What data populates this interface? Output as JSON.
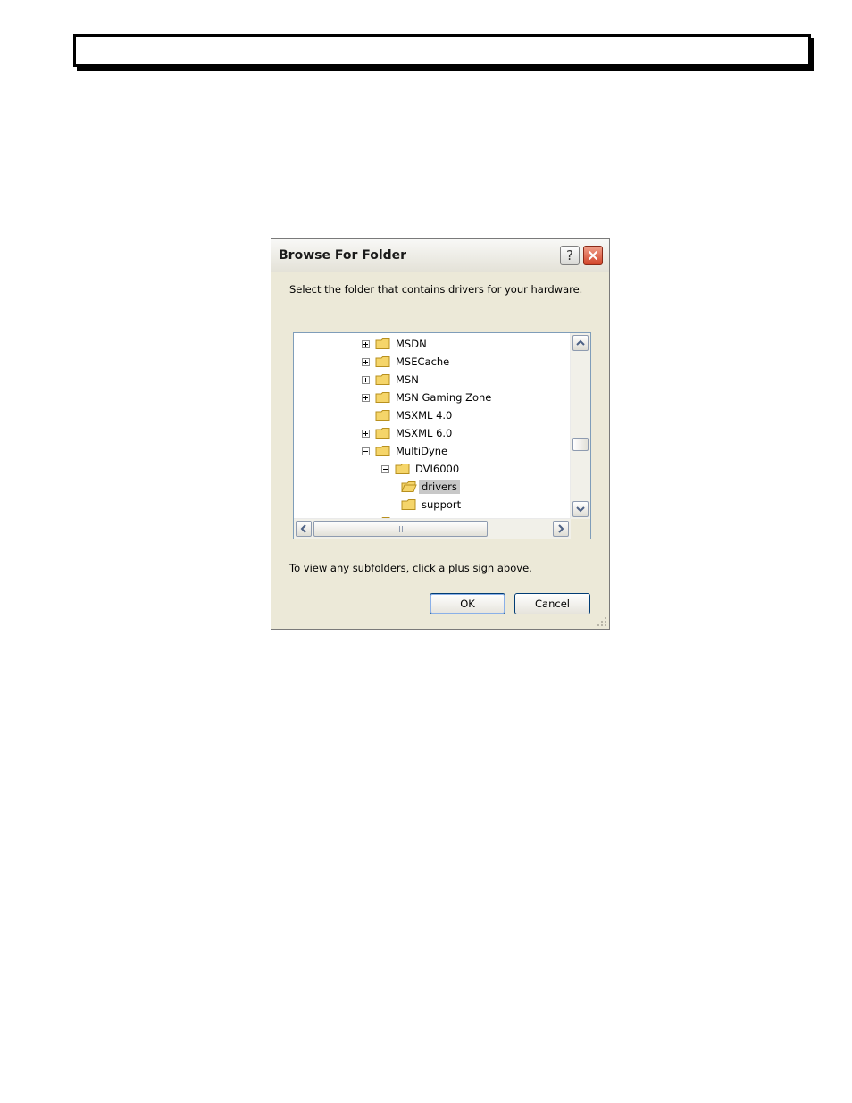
{
  "dialog": {
    "title": "Browse For Folder",
    "help_label": "?",
    "prompt": "Select the folder that contains drivers for your hardware.",
    "hint": "To view any subfolders, click a plus sign above.",
    "ok_label": "OK",
    "cancel_label": "Cancel"
  },
  "tree": {
    "items": [
      {
        "label": "MSDN",
        "expander": "plus",
        "level": 0
      },
      {
        "label": "MSECache",
        "expander": "plus",
        "level": 0
      },
      {
        "label": "MSN",
        "expander": "plus",
        "level": 0
      },
      {
        "label": "MSN Gaming Zone",
        "expander": "plus",
        "level": 0
      },
      {
        "label": "MSXML 4.0",
        "expander": "none",
        "level": 0
      },
      {
        "label": "MSXML 6.0",
        "expander": "plus",
        "level": 0
      },
      {
        "label": "MultiDyne",
        "expander": "minus",
        "level": 0
      },
      {
        "label": "DVI6000",
        "expander": "minus",
        "level": 1
      },
      {
        "label": "drivers",
        "expander": "none",
        "level": 2,
        "selected": true
      },
      {
        "label": "support",
        "expander": "none",
        "level": 2
      }
    ]
  },
  "colors": {
    "folder_fill": "#f5d56a",
    "folder_stroke": "#b8901e",
    "selection": "#c8c8c8",
    "close_button": "#d2452a",
    "tree_border": "#7f9db9"
  },
  "icons": {
    "close": "close-icon",
    "help": "question-mark-icon",
    "folder": "folder-icon",
    "scroll_up": "chevron-up-icon",
    "scroll_down": "chevron-down-icon",
    "scroll_left": "chevron-left-icon",
    "scroll_right": "chevron-right-icon"
  }
}
